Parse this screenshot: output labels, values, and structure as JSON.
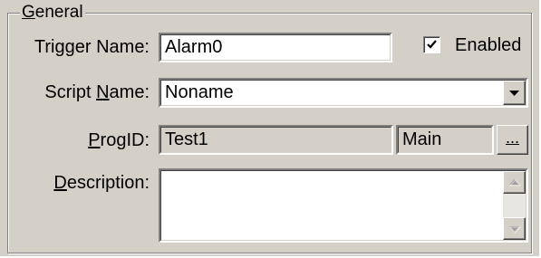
{
  "group": {
    "title": "General",
    "title_accesskey": "G",
    "title_rest": "eneral"
  },
  "trigger_name": {
    "label": "Trigger Name:",
    "value": "Alarm0"
  },
  "enabled": {
    "label": "Enabled",
    "checked": true
  },
  "script_name": {
    "label": "Script Name:",
    "label_before": "Script ",
    "label_accesskey": "N",
    "label_after": "ame:",
    "value": "Noname"
  },
  "prog_id": {
    "label": "ProgID:",
    "label_accesskey": "P",
    "label_rest": "rogID:",
    "value": "Test1",
    "secondary_value": "Main",
    "browse_label": "..."
  },
  "description": {
    "label": "Description:",
    "label_accesskey": "D",
    "label_rest": "escription:",
    "value": ""
  },
  "icons": {
    "dropdown": "chevron-down-icon",
    "scroll_up": "scroll-up-arrow-icon",
    "scroll_down": "scroll-down-arrow-icon",
    "check": "checkmark-icon"
  },
  "colors": {
    "face": "#d4d0c8",
    "shadow": "#808080",
    "dark_shadow": "#404040",
    "highlight": "#ffffff",
    "disabled_arrow": "#a0a0a0"
  }
}
